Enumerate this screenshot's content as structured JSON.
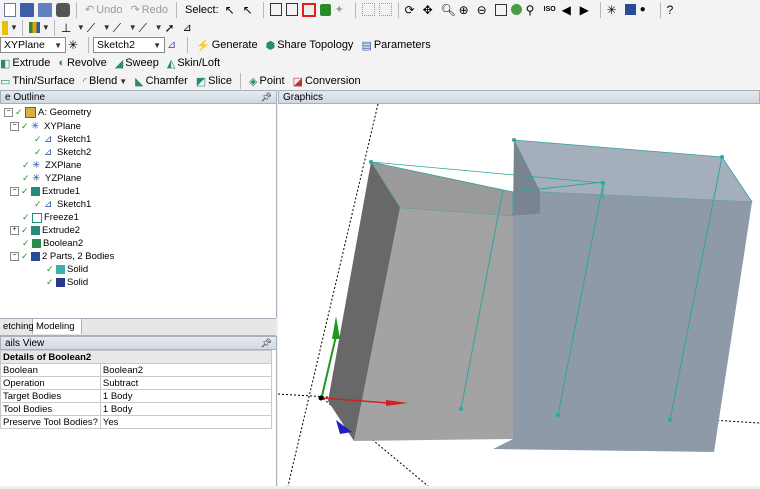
{
  "toolbar1": {
    "undo_label": "Undo",
    "redo_label": "Redo",
    "select_label": "Select:"
  },
  "toolbar2": {
    "plane_value": "XYPlane",
    "sketch_value": "Sketch2",
    "generate_label": "Generate",
    "share_topology_label": "Share Topology",
    "parameters_label": "Parameters"
  },
  "toolbar3": {
    "extrude_label": "Extrude",
    "revolve_label": "Revolve",
    "sweep_label": "Sweep",
    "skin_loft_label": "Skin/Loft"
  },
  "toolbar4": {
    "thin_surface_label": "Thin/Surface",
    "blend_label": "Blend",
    "chamfer_label": "Chamfer",
    "slice_label": "Slice",
    "point_label": "Point",
    "conversion_label": "Conversion"
  },
  "outline": {
    "title": "e Outline",
    "pin": "ᵠ",
    "nodes": [
      {
        "label": "A: Geometry"
      },
      {
        "label": "XYPlane"
      },
      {
        "label": "Sketch1"
      },
      {
        "label": "Sketch2"
      },
      {
        "label": "ZXPlane"
      },
      {
        "label": "YZPlane"
      },
      {
        "label": "Extrude1"
      },
      {
        "label": "Sketch1"
      },
      {
        "label": "Freeze1"
      },
      {
        "label": "Extrude2"
      },
      {
        "label": "Boolean2"
      },
      {
        "label": "2 Parts, 2 Bodies"
      },
      {
        "label": "Solid"
      },
      {
        "label": "Solid"
      }
    ]
  },
  "tabs": {
    "sketching": "etching",
    "modeling": "Modeling"
  },
  "details": {
    "title": "ails View",
    "pin": "ᵠ",
    "header": "Details of Boolean2",
    "rows": [
      {
        "name": "Boolean",
        "value": "Boolean2"
      },
      {
        "name": "Operation",
        "value": "Subtract"
      },
      {
        "name": "Target Bodies",
        "value": "1 Body"
      },
      {
        "name": "Tool Bodies",
        "value": "1 Body"
      },
      {
        "name": "Preserve Tool Bodies?",
        "value": "Yes"
      }
    ]
  },
  "graphics": {
    "title": "Graphics",
    "body_color": "#8f9aa8",
    "front_face_color": "#a3a3a3",
    "edge_color": "#2ca6a0"
  },
  "colors": {
    "highlight_box": "#e02020",
    "check_green": "#1a9a1a"
  }
}
